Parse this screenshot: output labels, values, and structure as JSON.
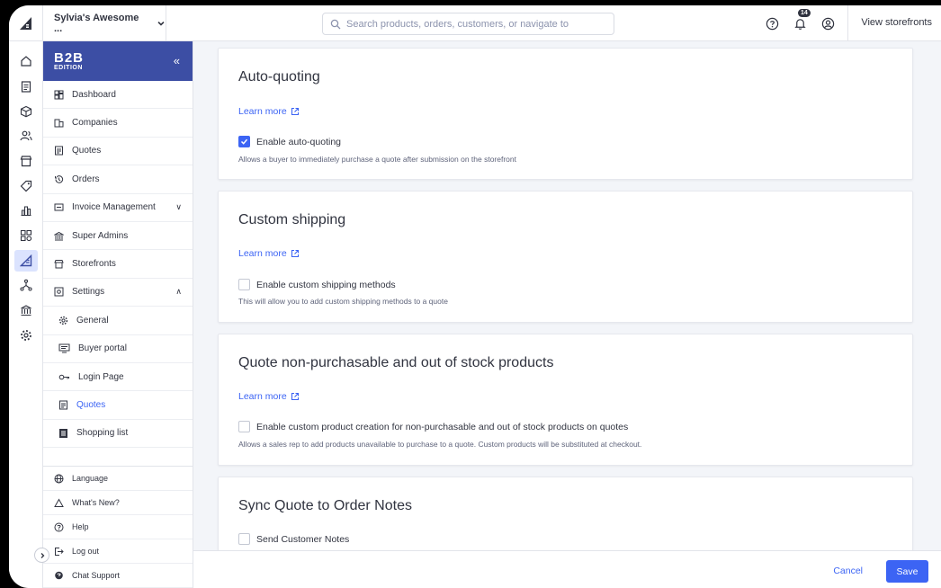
{
  "topbar": {
    "store_name": "Sylvia's Awesome ...",
    "search_placeholder": "Search products, orders, customers, or navigate to",
    "notification_count": "14",
    "view_storefronts": "View storefronts"
  },
  "b2b": {
    "logo_big": "B2B",
    "logo_small": "EDITION"
  },
  "nav": {
    "items": [
      {
        "label": "Dashboard"
      },
      {
        "label": "Companies"
      },
      {
        "label": "Quotes"
      },
      {
        "label": "Orders"
      },
      {
        "label": "Invoice Management"
      },
      {
        "label": "Super Admins"
      },
      {
        "label": "Storefronts"
      },
      {
        "label": "Settings"
      }
    ],
    "sub_items": [
      {
        "label": "General"
      },
      {
        "label": "Buyer portal"
      },
      {
        "label": "Login Page"
      },
      {
        "label": "Quotes"
      },
      {
        "label": "Shopping list"
      }
    ],
    "footer": [
      {
        "label": "Language"
      },
      {
        "label": "What's New?"
      },
      {
        "label": "Help"
      },
      {
        "label": "Log out"
      },
      {
        "label": "Chat Support"
      }
    ]
  },
  "cards": [
    {
      "title": "Auto-quoting",
      "learn": "Learn more",
      "checkbox": "Enable auto-quoting",
      "checked": true,
      "desc": "Allows a buyer to immediately purchase a quote after submission on the storefront"
    },
    {
      "title": "Custom shipping",
      "learn": "Learn more",
      "checkbox": "Enable custom shipping methods",
      "checked": false,
      "desc": "This will allow you to add custom shipping methods to a quote"
    },
    {
      "title": "Quote non-purchasable and out of stock products",
      "learn": "Learn more",
      "checkbox": "Enable custom product creation for non-purchasable and out of stock products on quotes",
      "checked": false,
      "desc": "Allows a sales rep to add products unavailable to purchase to a quote. Custom products will be substituted at checkout."
    },
    {
      "title": "Sync Quote to Order Notes",
      "checkbox": "Send Customer Notes",
      "checked": false
    }
  ],
  "actions": {
    "cancel": "Cancel",
    "save": "Save"
  },
  "colors": {
    "accent": "#3c64f4",
    "b2b_header": "#3c4ea4",
    "text": "#313440"
  }
}
